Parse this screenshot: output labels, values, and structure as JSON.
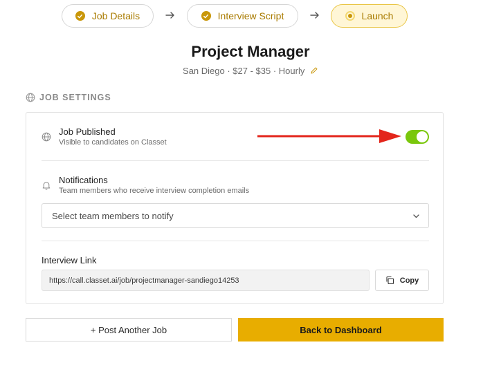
{
  "stepper": {
    "steps": [
      {
        "label": "Job Details",
        "state": "done"
      },
      {
        "label": "Interview Script",
        "state": "done"
      },
      {
        "label": "Launch",
        "state": "active"
      }
    ]
  },
  "header": {
    "title": "Project Manager",
    "subtitle": "San Diego · $27 - $35 · Hourly"
  },
  "section": {
    "title": "JOB SETTINGS"
  },
  "settings": {
    "published": {
      "title": "Job Published",
      "description": "Visible to candidates on Classet",
      "enabled": true
    },
    "notifications": {
      "title": "Notifications",
      "description": "Team members who receive interview completion emails",
      "select_placeholder": "Select team members to notify"
    },
    "interview_link": {
      "label": "Interview Link",
      "url": "https://call.classet.ai/job/projectmanager-sandiego14253",
      "copy_label": "Copy"
    }
  },
  "actions": {
    "post_another": "+ Post Another Job",
    "back_dashboard": "Back to Dashboard"
  },
  "colors": {
    "accent": "#e8ad00",
    "toggle_on": "#7ac70c",
    "annotation_arrow": "#e3251b"
  }
}
